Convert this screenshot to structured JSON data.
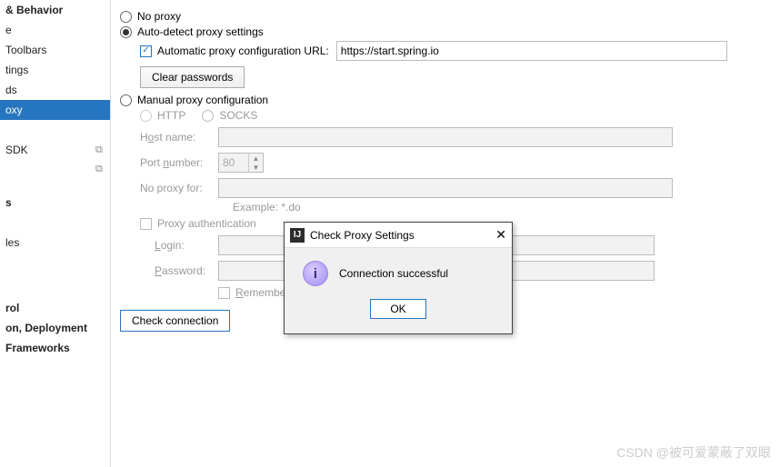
{
  "sidebar": {
    "items": [
      {
        "label": "& Behavior",
        "bold": true
      },
      {
        "label": "e"
      },
      {
        "label": " Toolbars"
      },
      {
        "label": "tings"
      },
      {
        "label": "ds"
      },
      {
        "label": "oxy",
        "selected": true
      },
      {
        "label": ""
      },
      {
        "label": " SDK",
        "copy": true
      },
      {
        "label": "",
        "copy": true
      },
      {
        "label": ""
      },
      {
        "label": "s",
        "bold": true
      },
      {
        "label": ""
      },
      {
        "label": "les"
      },
      {
        "label": ""
      },
      {
        "label": ""
      },
      {
        "label": "rol",
        "bold": true
      },
      {
        "label": "on, Deployment",
        "bold": true
      },
      {
        "label": "Frameworks",
        "bold": true
      }
    ]
  },
  "main": {
    "no_proxy": "No proxy",
    "auto_detect": "Auto-detect proxy settings",
    "auto_url_label": "Automatic proxy configuration URL:",
    "auto_url_value": "https://start.spring.io",
    "clear_passwords": "Clear passwords",
    "manual": "Manual proxy configuration",
    "http": "HTTP",
    "socks": "SOCKS",
    "hostname_label_pre": "H",
    "hostname_label_u": "o",
    "hostname_label_post": "st name:",
    "port_label_pre": "Port ",
    "port_label_u": "n",
    "port_label_post": "umber:",
    "port_value": "80",
    "no_proxy_for": "No proxy for:",
    "example": "Example: *.do",
    "proxy_auth": "Proxy authentication",
    "login_label": "Login:",
    "password_label": "Password:",
    "remember_label_u": "R",
    "remember_label_post": "emember",
    "check_connection": "Check connection"
  },
  "dialog": {
    "title": "Check Proxy Settings",
    "message": "Connection successful",
    "ok": "OK"
  },
  "watermark": "CSDN @被可爱蒙蔽了双眼"
}
